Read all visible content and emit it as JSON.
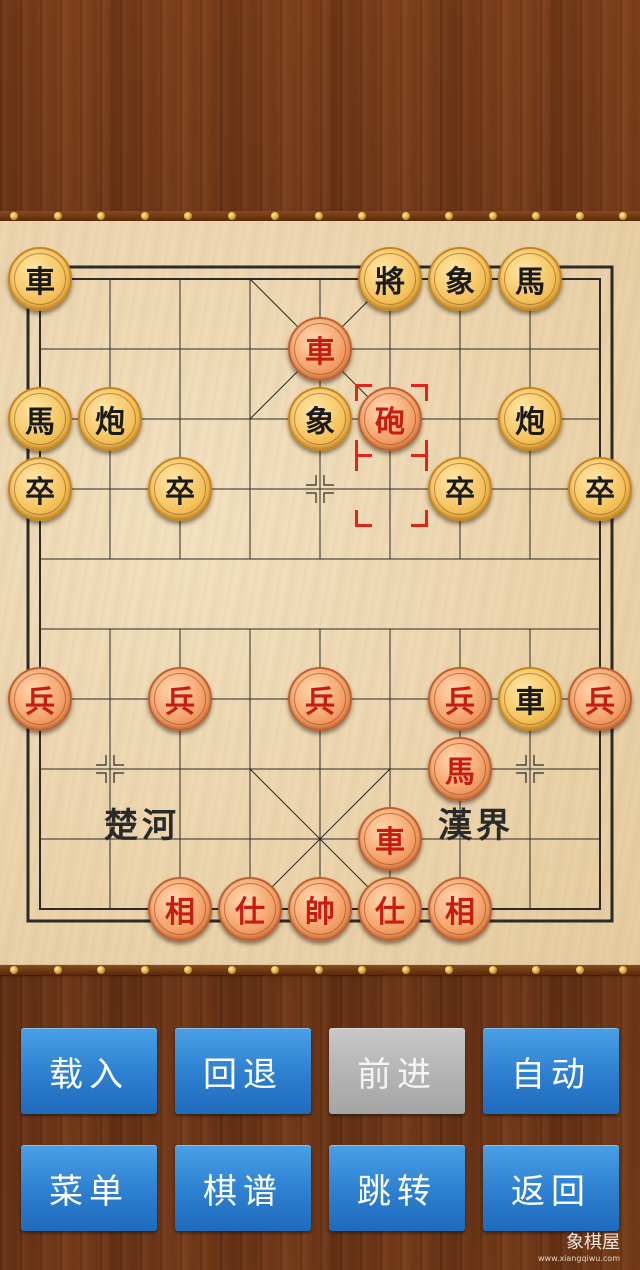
{
  "board": {
    "river_left": "楚河",
    "river_right": "漢界"
  },
  "pieces": [
    {
      "label": "車",
      "color": "black",
      "col": 0,
      "row": 0
    },
    {
      "label": "將",
      "color": "black",
      "col": 5,
      "row": 0
    },
    {
      "label": "象",
      "color": "black",
      "col": 6,
      "row": 0
    },
    {
      "label": "馬",
      "color": "black",
      "col": 7,
      "row": 0
    },
    {
      "label": "車",
      "color": "red",
      "col": 4,
      "row": 1
    },
    {
      "label": "馬",
      "color": "black",
      "col": 0,
      "row": 2
    },
    {
      "label": "炮",
      "color": "black",
      "col": 1,
      "row": 2
    },
    {
      "label": "象",
      "color": "black",
      "col": 4,
      "row": 2
    },
    {
      "label": "砲",
      "color": "red",
      "col": 5,
      "row": 2
    },
    {
      "label": "炮",
      "color": "black",
      "col": 7,
      "row": 2
    },
    {
      "label": "卒",
      "color": "black",
      "col": 0,
      "row": 3
    },
    {
      "label": "卒",
      "color": "black",
      "col": 2,
      "row": 3
    },
    {
      "label": "卒",
      "color": "black",
      "col": 6,
      "row": 3
    },
    {
      "label": "卒",
      "color": "black",
      "col": 8,
      "row": 3
    },
    {
      "label": "兵",
      "color": "red",
      "col": 0,
      "row": 6
    },
    {
      "label": "兵",
      "color": "red",
      "col": 2,
      "row": 6
    },
    {
      "label": "兵",
      "color": "red",
      "col": 4,
      "row": 6
    },
    {
      "label": "兵",
      "color": "red",
      "col": 6,
      "row": 6
    },
    {
      "label": "車",
      "color": "black",
      "col": 7,
      "row": 6
    },
    {
      "label": "兵",
      "color": "red",
      "col": 8,
      "row": 6
    },
    {
      "label": "馬",
      "color": "red",
      "col": 6,
      "row": 7
    },
    {
      "label": "車",
      "color": "red",
      "col": 5,
      "row": 8
    },
    {
      "label": "相",
      "color": "red",
      "col": 2,
      "row": 9
    },
    {
      "label": "仕",
      "color": "red",
      "col": 3,
      "row": 9
    },
    {
      "label": "帥",
      "color": "red",
      "col": 4,
      "row": 9
    },
    {
      "label": "仕",
      "color": "red",
      "col": 5,
      "row": 9
    },
    {
      "label": "相",
      "color": "red",
      "col": 6,
      "row": 9
    }
  ],
  "selected": {
    "col": 5,
    "row": 2
  },
  "buttons": {
    "load": "载入",
    "undo": "回退",
    "forward": "前进",
    "auto": "自动",
    "menu": "菜单",
    "record": "棋谱",
    "jump": "跳转",
    "back": "返回"
  },
  "watermark": {
    "title": "象棋屋",
    "url": "www.xiangqiwu.com"
  },
  "colors": {
    "red_piece_text": "#c81c10",
    "black_piece_text": "#1b1b1b",
    "button_blue": "#2d7fd0",
    "button_disabled": "#b3b3b3",
    "selection": "#e0251a"
  }
}
